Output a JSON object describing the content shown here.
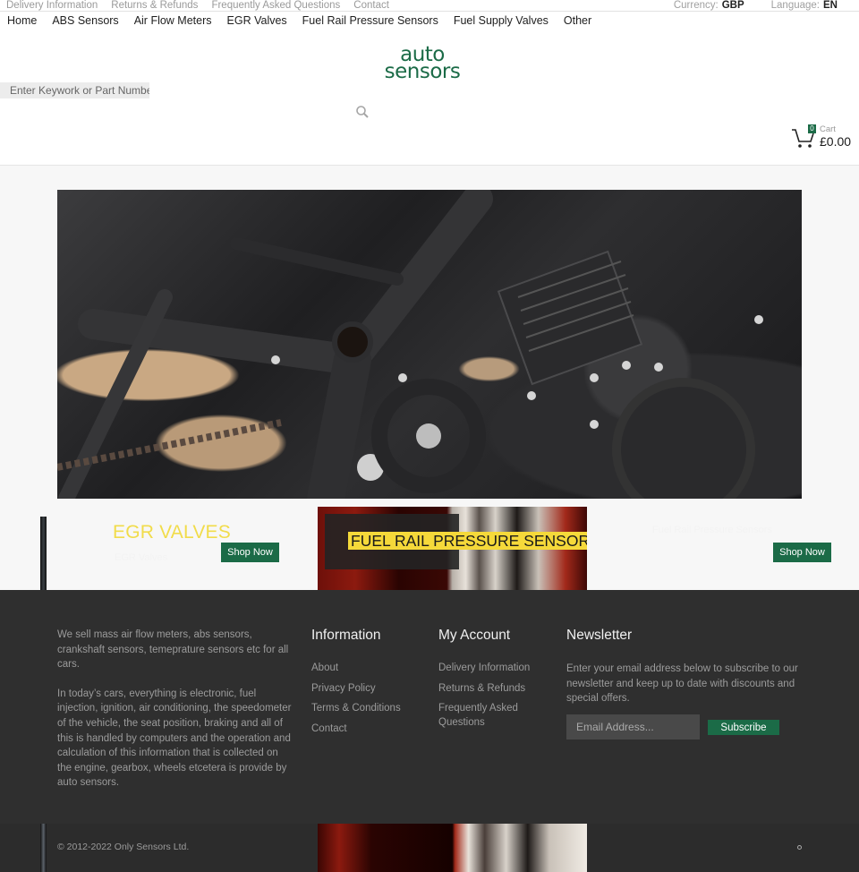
{
  "topbar": {
    "links": [
      "Delivery Information",
      "Returns & Refunds",
      "Frequently Asked Questions",
      "Contact"
    ],
    "currency": {
      "label": "Currency:",
      "value": "GBP"
    },
    "language": {
      "label": "Language:",
      "value": "EN"
    }
  },
  "nav": {
    "items": [
      "Home",
      "ABS Sensors",
      "Air Flow Meters",
      "EGR Valves",
      "Fuel Rail Pressure Sensors",
      "Fuel Supply Valves",
      "Other"
    ]
  },
  "logo": {
    "line1": "auto",
    "line2": "sensors",
    "color": "#1b6b47"
  },
  "search": {
    "placeholder": "Enter Keywork or Part Number",
    "value": "",
    "icon": "search-icon"
  },
  "cart": {
    "count": "0",
    "label": "Cart",
    "total": "£0.00",
    "icon": "cart-icon"
  },
  "hero": {
    "alt": "Wet black motorcycle frame and engine close-up"
  },
  "banners": [
    {
      "title": "EGR VALVES",
      "subtitle": "EGR Valves",
      "button": "Shop Now"
    },
    {
      "title": "FUEL RAIL PRESSURE SENSORS"
    },
    {
      "title": "Fuel Rail Pressure Sensors",
      "button": "Shop Now"
    }
  ],
  "footer": {
    "about": [
      "We sell mass air flow meters, abs sensors, crankshaft sensors, temeprature sensors etc for all cars.",
      "In today’s cars, everything is electronic, fuel injection, ignition, air conditioning, the speedometer of the vehicle, the seat position, braking and all of this is handled by computers and the operation and calculation of this information that is collected on the engine, gearbox, wheels etcetera is provide by auto sensors."
    ],
    "information": {
      "title": "Information",
      "links": [
        "About",
        "Privacy Policy",
        "Terms & Conditions",
        "Contact"
      ]
    },
    "account": {
      "title": "My Account",
      "links": [
        "Delivery Information",
        "Returns & Refunds",
        "Frequently Asked Questions"
      ]
    },
    "newsletter": {
      "title": "Newsletter",
      "text": "Enter your email address below to subscribe to our newsletter and keep up to date with discounts and special offers.",
      "placeholder": "Email Address...",
      "button": "Subscribe"
    },
    "copyright": "© 2012-2022 Only Sensors Ltd."
  },
  "colors": {
    "accent": "#1b6b47",
    "highlight": "#f5d93a",
    "footer_bg": "#2f2f2f"
  }
}
